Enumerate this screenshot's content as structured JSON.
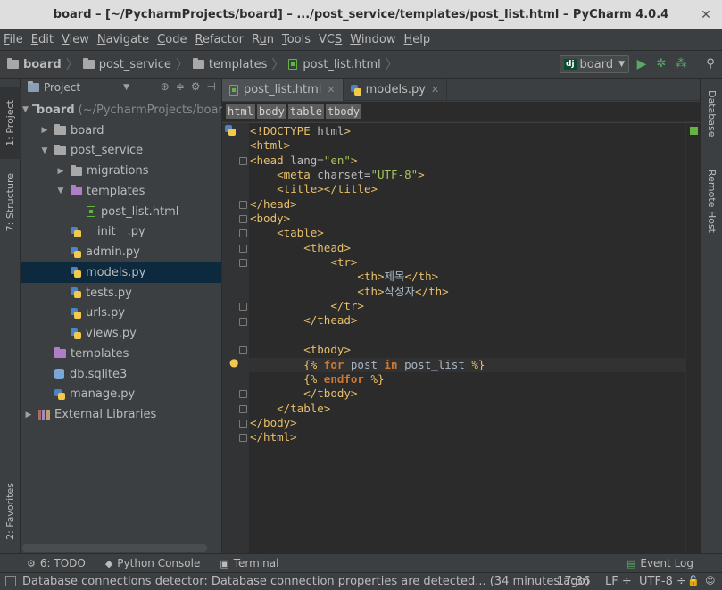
{
  "window": {
    "title": "board – [~/PycharmProjects/board] – .../post_service/templates/post_list.html – PyCharm 4.0.4"
  },
  "menu": [
    {
      "pre": "",
      "u": "F",
      "post": "ile"
    },
    {
      "pre": "",
      "u": "E",
      "post": "dit"
    },
    {
      "pre": "",
      "u": "V",
      "post": "iew"
    },
    {
      "pre": "",
      "u": "N",
      "post": "avigate"
    },
    {
      "pre": "",
      "u": "C",
      "post": "ode"
    },
    {
      "pre": "",
      "u": "R",
      "post": "efactor"
    },
    {
      "pre": "R",
      "u": "u",
      "post": "n"
    },
    {
      "pre": "",
      "u": "T",
      "post": "ools"
    },
    {
      "pre": "VC",
      "u": "S",
      "post": ""
    },
    {
      "pre": "",
      "u": "W",
      "post": "indow"
    },
    {
      "pre": "",
      "u": "H",
      "post": "elp"
    }
  ],
  "navbar": {
    "crumbs": [
      "board",
      "post_service",
      "templates",
      "post_list.html"
    ],
    "run_config": "board",
    "run_badge": "dj"
  },
  "left_tabs": {
    "project": "1: Project",
    "structure": "7: Structure",
    "favorites": "2: Favorites"
  },
  "right_tabs": {
    "database": "Database",
    "remote": "Remote Host"
  },
  "project_panel": {
    "header": "Project",
    "root": {
      "name": "board",
      "path": "(~/PycharmProjects/boar"
    },
    "items": [
      {
        "label": "board",
        "kind": "folder",
        "depth": 1,
        "arrow": "right"
      },
      {
        "label": "post_service",
        "kind": "folder",
        "depth": 1,
        "arrow": "down"
      },
      {
        "label": "migrations",
        "kind": "folder",
        "depth": 2,
        "arrow": "right"
      },
      {
        "label": "templates",
        "kind": "folder-purple",
        "depth": 2,
        "arrow": "down"
      },
      {
        "label": "post_list.html",
        "kind": "html",
        "depth": 3,
        "arrow": ""
      },
      {
        "label": "__init__.py",
        "kind": "py",
        "depth": 2,
        "arrow": ""
      },
      {
        "label": "admin.py",
        "kind": "py",
        "depth": 2,
        "arrow": ""
      },
      {
        "label": "models.py",
        "kind": "py",
        "depth": 2,
        "arrow": "",
        "selected": true
      },
      {
        "label": "tests.py",
        "kind": "py",
        "depth": 2,
        "arrow": ""
      },
      {
        "label": "urls.py",
        "kind": "py",
        "depth": 2,
        "arrow": ""
      },
      {
        "label": "views.py",
        "kind": "py",
        "depth": 2,
        "arrow": ""
      },
      {
        "label": "templates",
        "kind": "folder-purple",
        "depth": 1,
        "arrow": ""
      },
      {
        "label": "db.sqlite3",
        "kind": "db",
        "depth": 1,
        "arrow": ""
      },
      {
        "label": "manage.py",
        "kind": "py",
        "depth": 1,
        "arrow": ""
      },
      {
        "label": "External Libraries",
        "kind": "lib",
        "depth": 0,
        "arrow": "right"
      }
    ]
  },
  "editor_tabs": [
    {
      "label": "post_list.html",
      "kind": "html",
      "active": true
    },
    {
      "label": "models.py",
      "kind": "py",
      "active": false
    }
  ],
  "tag_breadcrumb": [
    "html",
    "body",
    "table",
    "tbody"
  ],
  "code_lines": [
    [
      [
        "t-tag",
        "<!DOCTYPE "
      ],
      [
        "t-attr",
        "html"
      ],
      [
        "t-tag",
        ">"
      ]
    ],
    [
      [
        "t-tag",
        "<html>"
      ]
    ],
    [
      [
        "t-tag",
        "<head "
      ],
      [
        "t-attr",
        "lang="
      ],
      [
        "t-str",
        "\"en\""
      ],
      [
        "t-tag",
        ">"
      ]
    ],
    [
      [
        "t-txt",
        "    "
      ],
      [
        "t-tag",
        "<meta "
      ],
      [
        "t-attr",
        "charset="
      ],
      [
        "t-str",
        "\"UTF-8\""
      ],
      [
        "t-tag",
        ">"
      ]
    ],
    [
      [
        "t-txt",
        "    "
      ],
      [
        "t-tag",
        "<title></title>"
      ]
    ],
    [
      [
        "t-tag",
        "</head>"
      ]
    ],
    [
      [
        "t-tag",
        "<body>"
      ]
    ],
    [
      [
        "t-txt",
        "    "
      ],
      [
        "t-tag",
        "<table>"
      ]
    ],
    [
      [
        "t-txt",
        "        "
      ],
      [
        "t-tag",
        "<thead>"
      ]
    ],
    [
      [
        "t-txt",
        "            "
      ],
      [
        "t-tag",
        "<tr>"
      ]
    ],
    [
      [
        "t-txt",
        "                "
      ],
      [
        "t-tag",
        "<th>"
      ],
      [
        "t-txt",
        "제목"
      ],
      [
        "t-tag",
        "</th>"
      ]
    ],
    [
      [
        "t-txt",
        "                "
      ],
      [
        "t-tag",
        "<th>"
      ],
      [
        "t-txt",
        "작성자"
      ],
      [
        "t-tag",
        "</th>"
      ]
    ],
    [
      [
        "t-txt",
        "            "
      ],
      [
        "t-tag",
        "</tr>"
      ]
    ],
    [
      [
        "t-txt",
        "        "
      ],
      [
        "t-tag",
        "</thead>"
      ]
    ],
    [
      [
        "t-txt",
        ""
      ]
    ],
    [
      [
        "t-txt",
        "        "
      ],
      [
        "t-tag",
        "<tbody>"
      ]
    ],
    [
      [
        "t-txt",
        "        "
      ],
      [
        "t-tpl",
        "{% "
      ],
      [
        "t-kw",
        "for"
      ],
      [
        "t-txt",
        " post "
      ],
      [
        "t-kw",
        "in"
      ],
      [
        "t-txt",
        " post_list "
      ],
      [
        "t-tpl",
        "%}"
      ]
    ],
    [
      [
        "t-txt",
        "        "
      ],
      [
        "t-tpl",
        "{% "
      ],
      [
        "t-kw",
        "endfor"
      ],
      [
        "t-tpl",
        " %}"
      ]
    ],
    [
      [
        "t-txt",
        "        "
      ],
      [
        "t-tag",
        "</tbody>"
      ]
    ],
    [
      [
        "t-txt",
        "    "
      ],
      [
        "t-tag",
        "</table>"
      ]
    ],
    [
      [
        "t-tag",
        "</body>"
      ]
    ],
    [
      [
        "t-tag",
        "</html>"
      ]
    ]
  ],
  "bottom_tabs": [
    {
      "label": "6: TODO",
      "icon": "todo-icon",
      "glyph": "⚙"
    },
    {
      "label": "Python Console",
      "icon": "python-console-icon",
      "glyph": "◆"
    },
    {
      "label": "Terminal",
      "icon": "terminal-icon",
      "glyph": "▣"
    }
  ],
  "event_log": "Event Log",
  "status": {
    "message": "Database connections detector: Database connection properties are detected... (34 minutes ago)",
    "position": "17:36",
    "line_sep": "LF ÷",
    "encoding": "UTF-8 ÷"
  }
}
